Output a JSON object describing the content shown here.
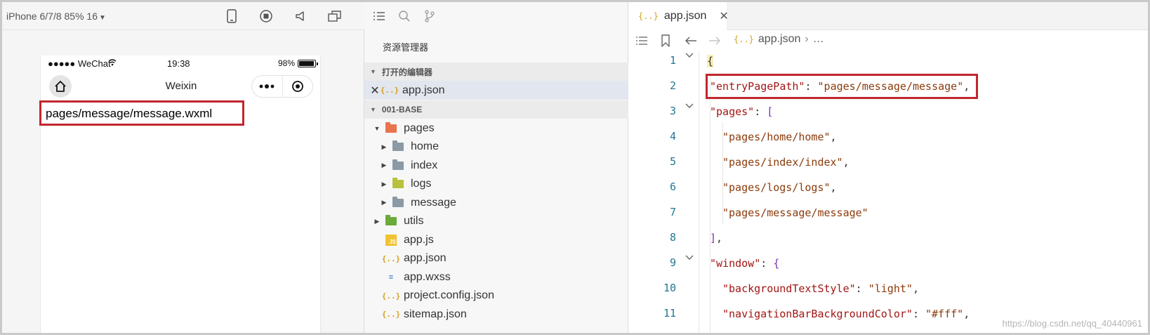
{
  "simulator": {
    "device_label": "iPhone 6/7/8 85% 16",
    "status": {
      "signal": "●●●●● WeChat",
      "time": "19:38",
      "battery_text": "98%",
      "battery_level": 0.98
    },
    "nav_title": "Weixin",
    "page_text": "pages/message/message.wxml"
  },
  "explorer": {
    "title": "资源管理器",
    "open_editors_label": "打开的编辑器",
    "open_editor_file": "app.json",
    "project_label": "001-BASE",
    "tree": [
      {
        "label": "pages",
        "type": "folder",
        "color": "#e8734d",
        "expanded": true,
        "depth": 0
      },
      {
        "label": "home",
        "type": "folder",
        "color": "#8a9aa6",
        "depth": 1
      },
      {
        "label": "index",
        "type": "folder",
        "color": "#8a9aa6",
        "depth": 1
      },
      {
        "label": "logs",
        "type": "folder",
        "color": "#b7c13c",
        "depth": 1
      },
      {
        "label": "message",
        "type": "folder",
        "color": "#8a9aa6",
        "depth": 1
      },
      {
        "label": "utils",
        "type": "folder",
        "color": "#6aab3a",
        "depth": 0
      },
      {
        "label": "app.js",
        "type": "js",
        "depth": 0
      },
      {
        "label": "app.json",
        "type": "json",
        "depth": 0
      },
      {
        "label": "app.wxss",
        "type": "css",
        "depth": 0
      },
      {
        "label": "project.config.json",
        "type": "json",
        "depth": 0
      },
      {
        "label": "sitemap.json",
        "type": "json",
        "depth": 0
      }
    ]
  },
  "editor": {
    "tab_label": "app.json",
    "breadcrumb_file": "app.json",
    "breadcrumb_more": "…",
    "line_numbers": [
      "1",
      "2",
      "3",
      "4",
      "5",
      "6",
      "7",
      "8",
      "9",
      "10",
      "11"
    ],
    "lines": {
      "l1": "{",
      "l2_key": "\"entryPagePath\"",
      "l2_colon": ": ",
      "l2_val": "\"pages/message/message\"",
      "l2_comma": ",",
      "l3_key": "\"pages\"",
      "l3_rest": ": ",
      "l3_bracket": "[",
      "l4": "\"pages/home/home\"",
      "l5": "\"pages/index/index\"",
      "l6": "\"pages/logs/logs\"",
      "l7": "\"pages/message/message\"",
      "comma": ",",
      "l8": "]",
      "l9_key": "\"window\"",
      "l9_rest": ": ",
      "l9_brace": "{",
      "l10_key": "\"backgroundTextStyle\"",
      "l10_val": "\"light\"",
      "l11_key": "\"navigationBarBackgroundColor\"",
      "l11_val": "\"#fff\""
    }
  },
  "watermark": "https://blog.csdn.net/qq_40440961",
  "colors": {
    "highlight": "#c0272d",
    "accent_json": "#d8a020"
  }
}
